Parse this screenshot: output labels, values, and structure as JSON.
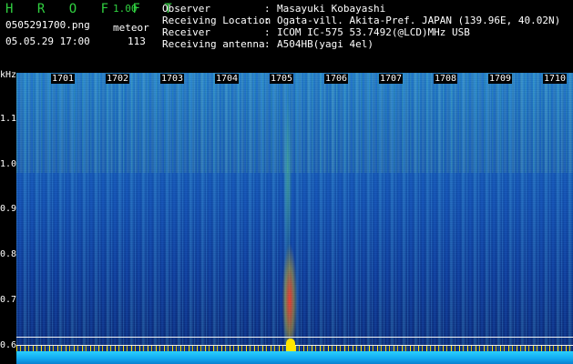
{
  "header": {
    "app_title": "H R O F F T",
    "app_version": "1.00",
    "file_name": "0505291700.png",
    "mode": "meteor",
    "datetime": "05.05.29 17:00",
    "count": "113",
    "info": [
      {
        "key": "Observer",
        "sep": ":",
        "value": "Masayuki Kobayashi"
      },
      {
        "key": "Receiving Location",
        "sep": ":",
        "value": "Ogata-vill. Akita-Pref. JAPAN (139.96E, 40.02N)"
      },
      {
        "key": "Receiver",
        "sep": ":",
        "value": "ICOM IC-575 53.7492(@LCD)MHz USB"
      },
      {
        "key": "Receiving antenna",
        "sep": ":",
        "value": "A504HB(yagi 4el)"
      }
    ]
  },
  "spectrogram": {
    "y_unit": "kHz",
    "y_labels": [
      "1.1",
      "1.0",
      "0.9",
      "0.8",
      "0.7",
      "0.6"
    ],
    "x_labels": [
      "1701",
      "1702",
      "1703",
      "1704",
      "1705",
      "1706",
      "1707",
      "1708",
      "1709",
      "1710"
    ]
  }
}
